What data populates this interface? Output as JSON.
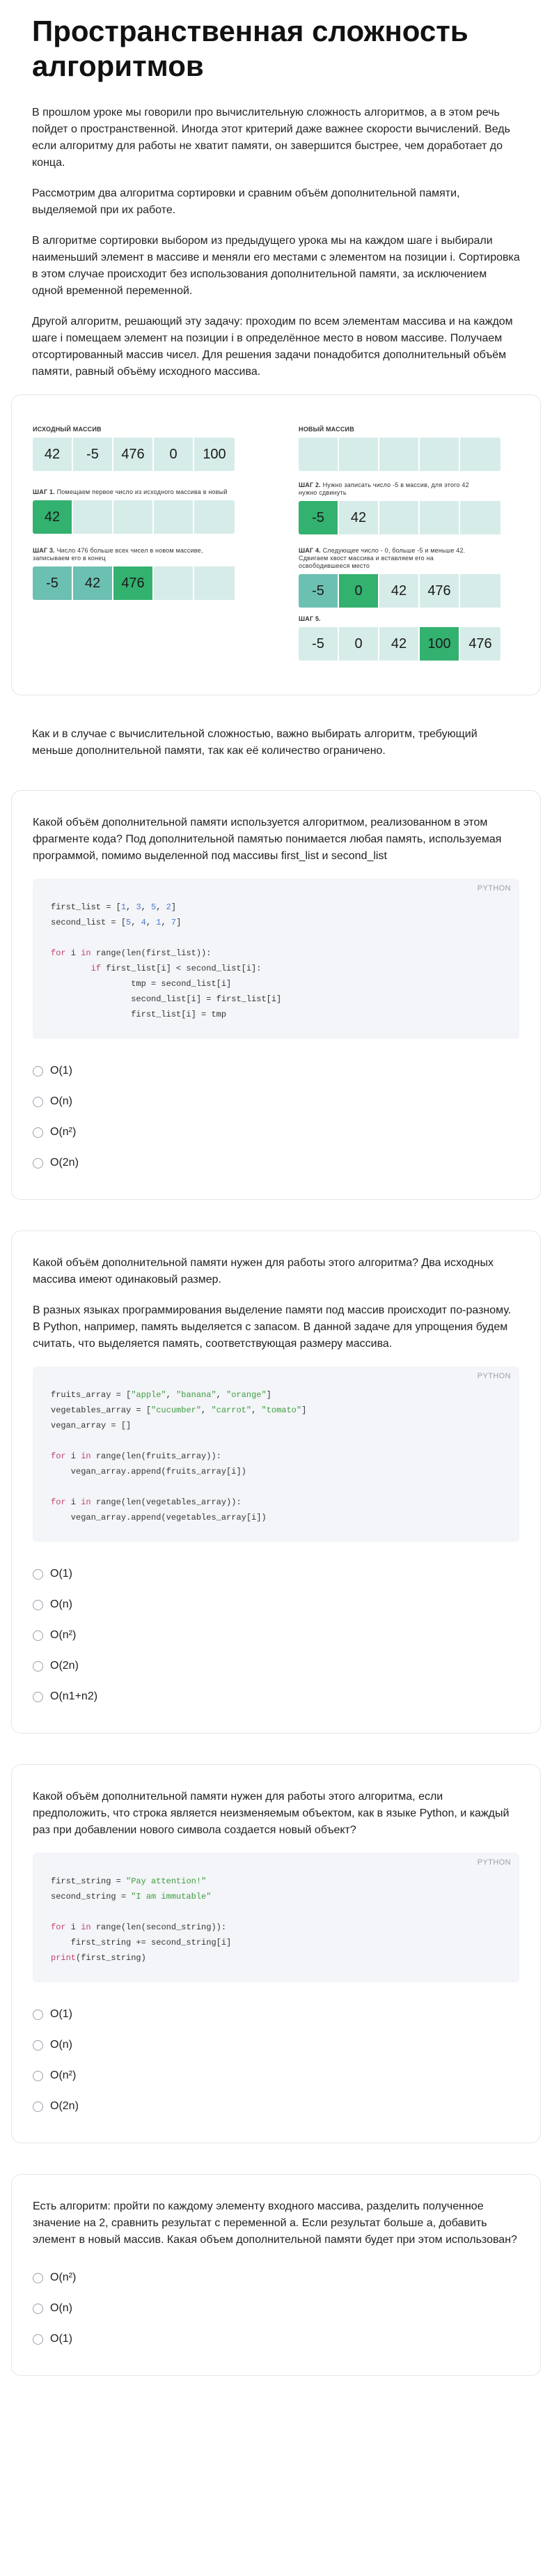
{
  "lesson": {
    "title": "Пространственная сложность алгоритмов",
    "paragraphs": [
      "В прошлом уроке мы говорили про вычислительную сложность алгоритмов, а в этом речь пойдет о пространственной. Иногда этот критерий даже важнее скорости вычислений. Ведь если алгоритму для работы не хватит памяти, он завершится быстрее, чем доработает до конца.",
      "Рассмотрим два алгоритма сортировки и сравним объём дополнительной памяти, выделяемой при их работе.",
      "В алгоритме сортировки выбором из предыдущего урока мы на каждом шаге i выбирали наименьший элемент в массиве и меняли его местами с элементом на позиции i. Сортировка в этом случае происходит без использования дополнительной памяти, за исключением одной временной переменной.",
      "Другой алгоритм, решающий эту задачу: проходим по всем элементам массива и на каждом шаге i помещаем элемент на позиции i в определённое место в новом массиве. Получаем отсортированный массив чисел. Для решения задачи понадобится дополнительный объём памяти, равный объёму исходного массива."
    ],
    "after_illustration": "Как и в случае с вычислительной сложностью, важно выбирать алгоритм, требующий меньше дополнительной памяти, так как её количество ограничено."
  },
  "illustration": {
    "source_caption": "ИСХОДНЫЙ МАССИВ",
    "source_cells": [
      "42",
      "-5",
      "476",
      "0",
      "100"
    ],
    "new_caption": "НОВЫЙ МАССИВ",
    "step1_caption": "ШАГ 1.",
    "step1_sub": "Помещаем первое число из исходного массива в новый",
    "step1_cells": [
      "42",
      "",
      "",
      "",
      ""
    ],
    "step2_caption": "ШАГ 2.",
    "step2_sub": "Нужно записать число -5 в массив, для этого 42 нужно сдвинуть",
    "step2_cells": [
      "-5",
      "42",
      "",
      "",
      ""
    ],
    "step3_caption": "ШАГ 3.",
    "step3_sub": "Число 476 больше всех чисел в новом массиве, записываем его в конец",
    "step3_cells": [
      "-5",
      "42",
      "476",
      "",
      ""
    ],
    "step4_caption": "ШАГ 4.",
    "step4_sub": "Следующее число - 0, больше -5 и меньше 42. Сдвигаем хвост массива и вставляем его на освободившееся место",
    "step4_cells": [
      "-5",
      "0",
      "42",
      "476",
      ""
    ],
    "step5_caption": "ШАГ 5.",
    "step5_cells": [
      "-5",
      "0",
      "42",
      "100",
      "476"
    ]
  },
  "quiz1": {
    "question": "Какой объём дополнительной памяти используется алгоритмом, реализованном в этом фрагменте кода? Под дополнительной памятью понимается любая память, используемая программой, помимо выделенной под массивы first_list и second_list",
    "lang": "PYTHON",
    "options": [
      "O(1)",
      "O(n)",
      "O(n²)",
      "O(2n)"
    ]
  },
  "quiz2": {
    "question": "Какой объём дополнительной памяти нужен для работы этого алгоритма? Два исходных массива имеют одинаковый размер.",
    "note": "В разных языках программирования выделение памяти под массив происходит по-разному. В Python, например, память выделяется с запасом. В данной задаче для упрощения будем считать, что выделяется память, соответствующая размеру массива.",
    "lang": "PYTHON",
    "options": [
      "O(1)",
      "O(n)",
      "O(n²)",
      "O(2n)",
      "O(n1+n2)"
    ]
  },
  "quiz3": {
    "question": "Какой объём дополнительной памяти нужен для работы этого алгоритма, если предположить, что строка является неизменяемым объектом, как в языке Python, и каждый раз при добавлении нового символа создается новый объект?",
    "lang": "PYTHON",
    "options": [
      "O(1)",
      "O(n)",
      "O(n²)",
      "O(2n)"
    ]
  },
  "quiz4": {
    "question": "Есть алгоритм: пройти по каждому элементу входного массива, разделить полученное значение на 2, сравнить результат с переменной a. Если результат больше a, добавить элемент в новый массив. Какая объем дополнительной памяти будет при этом использован?",
    "options": [
      "O(n²)",
      "O(n)",
      "O(1)"
    ]
  },
  "colors": {
    "cell_light": "#d6ece9",
    "cell_green": "#33b16f",
    "cell_teal": "#4fb6a0",
    "code_bg": "#f3f5f8"
  }
}
